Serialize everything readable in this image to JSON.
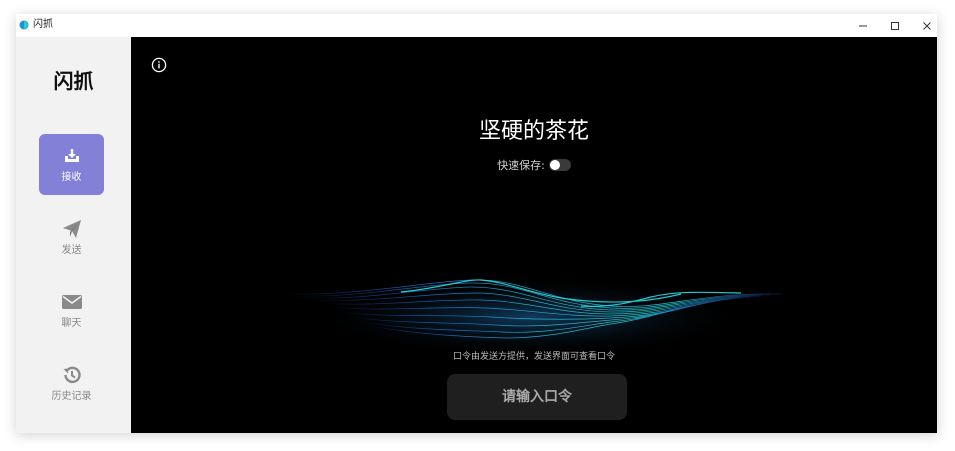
{
  "window": {
    "title": "闪抓"
  },
  "sidebar": {
    "logo": "闪抓",
    "items": [
      {
        "label": "接收",
        "icon": "download-tray-icon"
      },
      {
        "label": "发送",
        "icon": "paper-plane-icon"
      },
      {
        "label": "聊天",
        "icon": "envelope-icon"
      },
      {
        "label": "历史记录",
        "icon": "history-icon"
      }
    ],
    "active_index": 0
  },
  "main": {
    "device_name": "坚硬的茶花",
    "quick_save": {
      "label": "快速保存:",
      "enabled": false
    },
    "hint": "口令由发送方提供，发送界面可查看口令",
    "code_input": {
      "value": "",
      "placeholder": "请输入口令"
    }
  },
  "colors": {
    "active_nav": "#8380d8",
    "main_bg": "#000000",
    "sidebar_bg": "#f2f2f2",
    "wave_cyan": "#27e0e6",
    "wave_blue": "#2a6cff"
  }
}
